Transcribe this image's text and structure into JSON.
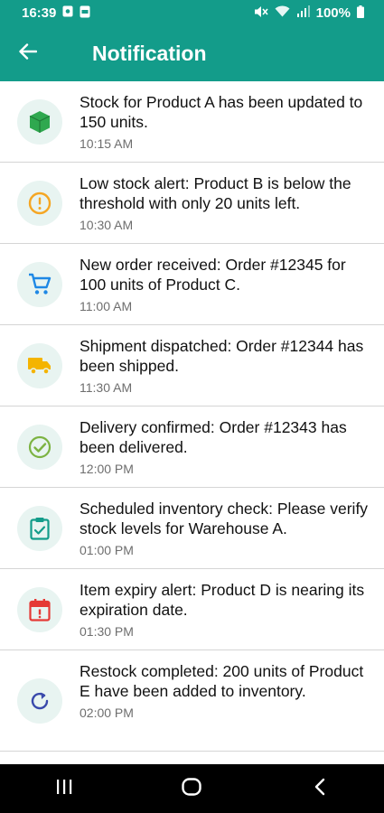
{
  "status_bar": {
    "time": "16:39",
    "battery": "100%"
  },
  "header": {
    "title": "Notification"
  },
  "notifications": [
    {
      "icon": "package-icon",
      "message": "Stock for Product A has been updated to 150 units.",
      "time": "10:15 AM",
      "color": "#2fa84f"
    },
    {
      "icon": "alert-circle-icon",
      "message": "Low stock alert: Product B is below the threshold with only 20 units left.",
      "time": "10:30 AM",
      "color": "#f5a623"
    },
    {
      "icon": "cart-icon",
      "message": "New order received: Order #12345 for 100 units of Product C.",
      "time": "11:00 AM",
      "color": "#1e88e5"
    },
    {
      "icon": "truck-icon",
      "message": "Shipment dispatched: Order #12344 has been shipped.",
      "time": "11:30 AM",
      "color": "#f4b400"
    },
    {
      "icon": "check-circle-icon",
      "message": "Delivery confirmed: Order #12343 has been delivered.",
      "time": "12:00 PM",
      "color": "#7cb342"
    },
    {
      "icon": "clipboard-check-icon",
      "message": "Scheduled inventory check: Please verify stock levels for Warehouse A.",
      "time": "01:00 PM",
      "color": "#139c8a"
    },
    {
      "icon": "calendar-alert-icon",
      "message": "Item expiry alert: Product D is nearing its expiration date.",
      "time": "01:30 PM",
      "color": "#e53935"
    },
    {
      "icon": "refresh-icon",
      "message": "Restock completed: 200 units of Product E have been added to inventory.",
      "time": "02:00 PM",
      "color": "#3949ab"
    }
  ]
}
